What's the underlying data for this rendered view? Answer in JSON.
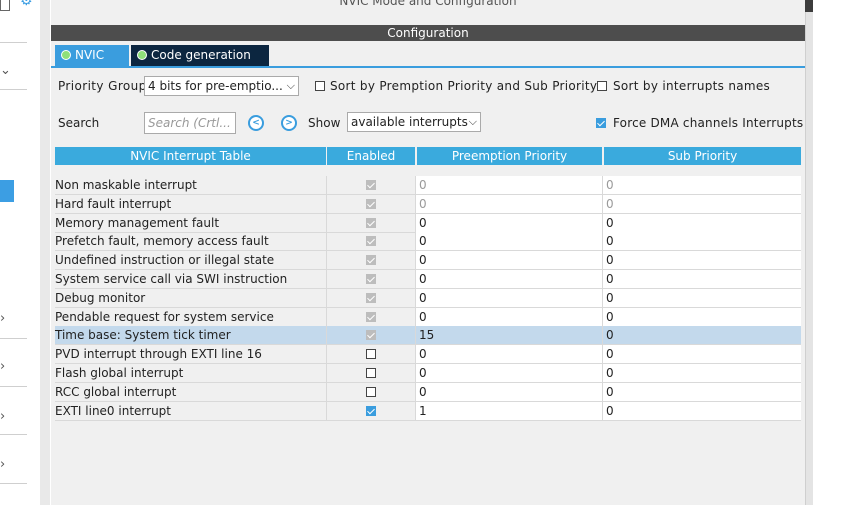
{
  "top_title": "NVIC Mode and Configuration",
  "config_header": "Configuration",
  "tabs": [
    {
      "label": "NVIC",
      "active": true
    },
    {
      "label": "Code generation",
      "active": false
    }
  ],
  "priority_group": {
    "label": "Priority Group",
    "value": "4 bits for pre-emptio..."
  },
  "sort_premption": {
    "label": "Sort by Premption Priority and Sub Priority",
    "checked": false
  },
  "sort_names": {
    "label": "Sort by interrupts names",
    "checked": false
  },
  "search": {
    "label": "Search",
    "placeholder": "Search (Crtl..."
  },
  "show": {
    "label": "Show",
    "value": "available interrupts"
  },
  "force_dma": {
    "label": "Force DMA channels Interrupts",
    "checked": true
  },
  "table": {
    "headers": [
      "NVIC Interrupt Table",
      "Enabled",
      "Preemption Priority",
      "Sub Priority"
    ],
    "rows": [
      {
        "name": "Non maskable interrupt",
        "enabled": "locked",
        "pre": "0",
        "sub": "0",
        "pre_disabled": true,
        "sub_disabled": true
      },
      {
        "name": "Hard fault interrupt",
        "enabled": "locked",
        "pre": "0",
        "sub": "0",
        "pre_disabled": true,
        "sub_disabled": true
      },
      {
        "name": "Memory management fault",
        "enabled": "locked",
        "pre": "0",
        "sub": "0"
      },
      {
        "name": "Prefetch fault, memory access fault",
        "enabled": "locked",
        "pre": "0",
        "sub": "0"
      },
      {
        "name": "Undefined instruction or illegal state",
        "enabled": "locked",
        "pre": "0",
        "sub": "0"
      },
      {
        "name": "System service call via SWI instruction",
        "enabled": "locked",
        "pre": "0",
        "sub": "0"
      },
      {
        "name": "Debug monitor",
        "enabled": "locked",
        "pre": "0",
        "sub": "0"
      },
      {
        "name": "Pendable request for system service",
        "enabled": "locked",
        "pre": "0",
        "sub": "0"
      },
      {
        "name": "Time base: System tick timer",
        "enabled": "locked",
        "pre": "15",
        "sub": "0",
        "selected": true
      },
      {
        "name": "PVD interrupt through EXTI line 16",
        "enabled": "off",
        "pre": "0",
        "sub": "0"
      },
      {
        "name": "Flash global interrupt",
        "enabled": "off",
        "pre": "0",
        "sub": "0"
      },
      {
        "name": "RCC global interrupt",
        "enabled": "off",
        "pre": "0",
        "sub": "0"
      },
      {
        "name": "EXTI line0 interrupt",
        "enabled": "on",
        "pre": "1",
        "sub": "0"
      }
    ]
  },
  "icons": {
    "nvic_tab": "check-circle-icon",
    "codegen_tab": "check-circle-icon",
    "search_prev": "arrow-left-circle-icon",
    "search_next": "arrow-right-circle-icon"
  },
  "colors": {
    "accent": "#3a9dde",
    "header_dark": "#4d4d4d",
    "tab_dark": "#0c2640",
    "selected_row": "#c3d9ec"
  }
}
